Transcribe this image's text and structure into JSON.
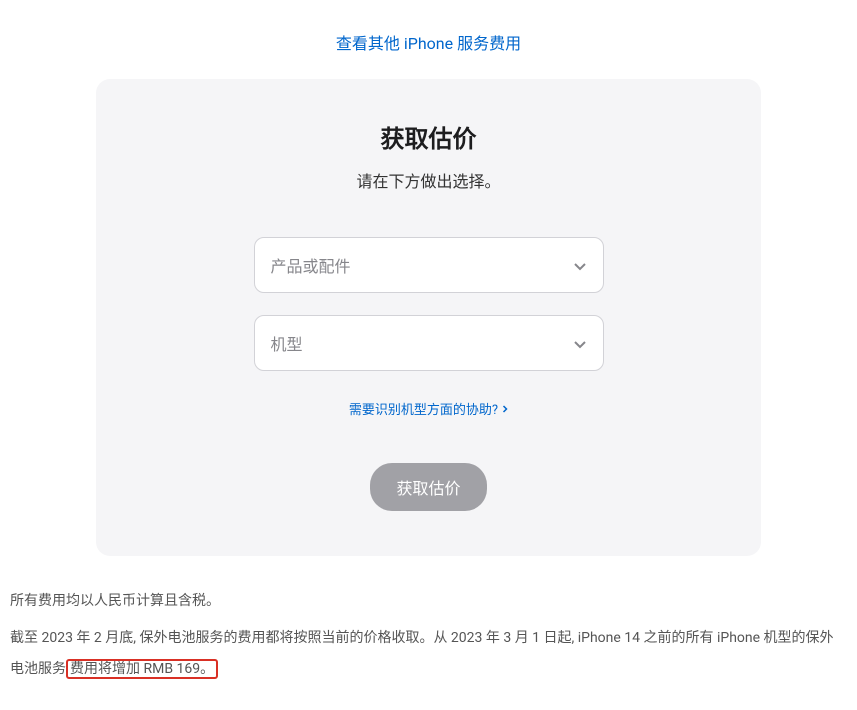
{
  "topLink": "查看其他 iPhone 服务费用",
  "card": {
    "title": "获取估价",
    "subtitle": "请在下方做出选择。",
    "select1": {
      "placeholder": "产品或配件"
    },
    "select2": {
      "placeholder": "机型"
    },
    "helpLink": "需要识别机型方面的协助?",
    "button": "获取估价"
  },
  "footer": {
    "fees_note": "所有费用均以人民币计算且含税。",
    "note_prefix": "截至 2023 年 2 月底, 保外电池服务的费用都将按照当前的价格收取。从 2023 年 3 月 1 日起, iPhone 14 之前的所有 iPhone 机型的保外电池服务",
    "note_highlight": "费用将增加 RMB 169。"
  }
}
